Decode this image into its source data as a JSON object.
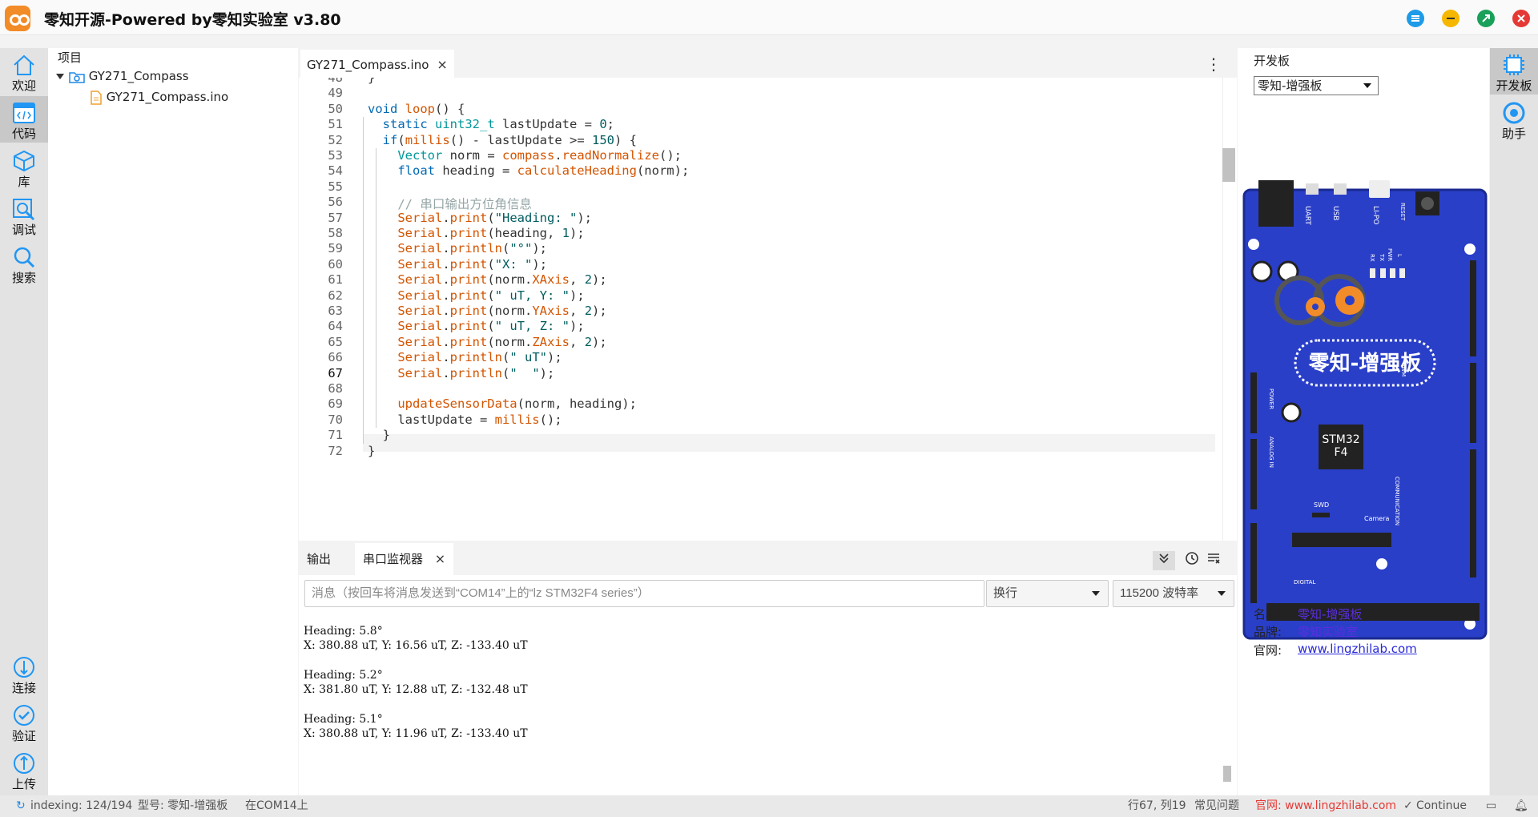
{
  "app": {
    "title": "零知开源-Powered by零知实验室 v3.80"
  },
  "leftbar": {
    "items": [
      {
        "label": "欢迎",
        "icon": "home-icon"
      },
      {
        "label": "代码",
        "icon": "code-icon"
      },
      {
        "label": "库",
        "icon": "cube-icon"
      },
      {
        "label": "调试",
        "icon": "debug-icon"
      },
      {
        "label": "搜索",
        "icon": "search-icon"
      },
      {
        "label": "连接",
        "icon": "connect-icon"
      },
      {
        "label": "验证",
        "icon": "check-icon"
      },
      {
        "label": "上传",
        "icon": "upload-icon"
      }
    ]
  },
  "project": {
    "header": "项目",
    "folder": "GY271_Compass",
    "file": "GY271_Compass.ino"
  },
  "editor": {
    "tab": "GY271_Compass.ino",
    "tab_close": "×",
    "menu": "⋮",
    "lines": [
      {
        "n": "48",
        "code": "}"
      },
      {
        "n": "49",
        "code": ""
      },
      {
        "n": "50",
        "code": "void loop() {"
      },
      {
        "n": "51",
        "code": "  static uint32_t lastUpdate = 0;"
      },
      {
        "n": "52",
        "code": "  if(millis() - lastUpdate >= 150) {"
      },
      {
        "n": "53",
        "code": "    Vector norm = compass.readNormalize();"
      },
      {
        "n": "54",
        "code": "    float heading = calculateHeading(norm);"
      },
      {
        "n": "55",
        "code": ""
      },
      {
        "n": "56",
        "code": "    // 串口输出方位角信息"
      },
      {
        "n": "57",
        "code": "    Serial.print(\"Heading: \");"
      },
      {
        "n": "58",
        "code": "    Serial.print(heading, 1);"
      },
      {
        "n": "59",
        "code": "    Serial.println(\"°\");"
      },
      {
        "n": "60",
        "code": "    Serial.print(\"X: \");"
      },
      {
        "n": "61",
        "code": "    Serial.print(norm.XAxis, 2);"
      },
      {
        "n": "62",
        "code": "    Serial.print(\" uT, Y: \");"
      },
      {
        "n": "63",
        "code": "    Serial.print(norm.YAxis, 2);"
      },
      {
        "n": "64",
        "code": "    Serial.print(\" uT, Z: \");"
      },
      {
        "n": "65",
        "code": "    Serial.print(norm.ZAxis, 2);"
      },
      {
        "n": "66",
        "code": "    Serial.println(\" uT\");"
      },
      {
        "n": "67",
        "code": "    Serial.println(\"  \");"
      },
      {
        "n": "68",
        "code": ""
      },
      {
        "n": "69",
        "code": "    updateSensorData(norm, heading);"
      },
      {
        "n": "70",
        "code": "    lastUpdate = millis();"
      },
      {
        "n": "71",
        "code": "  }"
      },
      {
        "n": "72",
        "code": "}"
      }
    ]
  },
  "bottom": {
    "tab_output": "输出",
    "tab_serial": "串口监视器",
    "tab_close": "×",
    "input_placeholder": "消息（按回车将消息发送到“COM14”上的“lz STM32F4 series”）",
    "line_ending": "换行",
    "baud": "115200 波特率",
    "output_lines": [
      "Heading: 5.8°",
      "X: 380.88 uT, Y: 16.56 uT, Z: -133.40 uT",
      "",
      "Heading: 5.2°",
      "X: 381.80 uT, Y: 12.88 uT, Z: -132.48 uT",
      "",
      "Heading: 5.1°",
      "X: 380.88 uT, Y: 11.96 uT, Z: -133.40 uT"
    ]
  },
  "rightpanel": {
    "title": "开发板",
    "board_select": "零知-增强板",
    "board_image": {
      "brand_label": "零知-增强板",
      "chip_label": "STM32\nF4",
      "labels": [
        "UART",
        "USB",
        "LI-PO",
        "RESET",
        "PWR",
        "TX",
        "RX",
        "L",
        "SWD",
        "Camera",
        "POWER",
        "ANALOG IN",
        "DIGITAL",
        "PWM",
        "COMMUNICATION"
      ]
    },
    "info": [
      {
        "key": "名称:",
        "val": "零知-增强板"
      },
      {
        "key": "品牌:",
        "val": "零知实验室"
      },
      {
        "key": "官网:",
        "val": "www.lingzhilab.com"
      }
    ]
  },
  "rightbar": {
    "items": [
      {
        "label": "开发板",
        "icon": "board-icon"
      },
      {
        "label": "助手",
        "icon": "assistant-icon"
      }
    ]
  },
  "status": {
    "indexing": "indexing: 124/194",
    "model": "型号: 零知-增强板",
    "port": "在COM14上",
    "position": "行67, 列19",
    "faq": "常见问题",
    "website": "官网: www.lingzhilab.com",
    "continue": "Continue"
  },
  "colors": {
    "accent": "#1e88e5",
    "board": "#2a3fc8",
    "logo": "#f28c28"
  }
}
